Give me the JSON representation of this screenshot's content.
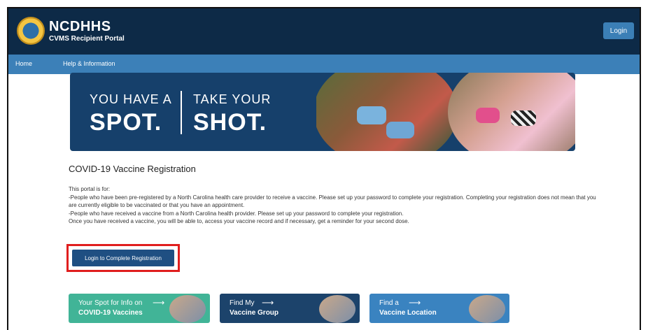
{
  "header": {
    "brand_title": "NCDHHS",
    "brand_subtitle": "CVMS Recipient Portal",
    "login_label": "Login"
  },
  "nav": {
    "items": [
      {
        "label": "Home"
      },
      {
        "label": "Help & Information"
      }
    ]
  },
  "banner": {
    "left_line1": "YOU HAVE A",
    "left_line2": "SPOT.",
    "right_line1": "TAKE YOUR",
    "right_line2": "SHOT."
  },
  "main": {
    "title": "COVID-19 Vaccine Registration",
    "paragraphs": [
      "This portal is for:",
      "-People who have been pre-registered by a North Carolina health care provider to receive a vaccine. Please set up your password to complete your registration. Completing your registration does not mean that you are currently eligible to be vaccinated or that you have an appointment.",
      "-People who have received a vaccine from a North Carolina health provider. Please set up your password to complete your registration.",
      "Once you have received a vaccine, you will be able to, access your vaccine record and if necessary, get a reminder for your second dose."
    ],
    "register_button": "Login to Complete Registration"
  },
  "cards": [
    {
      "small": "Your Spot for Info on",
      "big": "COVID-19 Vaccines",
      "arrow": "⟶",
      "color": "#41b497"
    },
    {
      "small": "Find My",
      "big": "Vaccine Group",
      "arrow": "⟶",
      "color": "#1c436b"
    },
    {
      "small": "Find a",
      "big": "Vaccine Location",
      "arrow": "⟶",
      "color": "#3a83c0"
    }
  ],
  "colors": {
    "header_bg": "#0d2a47",
    "nav_bg": "#3c80b8",
    "banner_bg": "#16406b",
    "button_bg": "#1f4f82",
    "highlight_border": "#e01e1e"
  }
}
